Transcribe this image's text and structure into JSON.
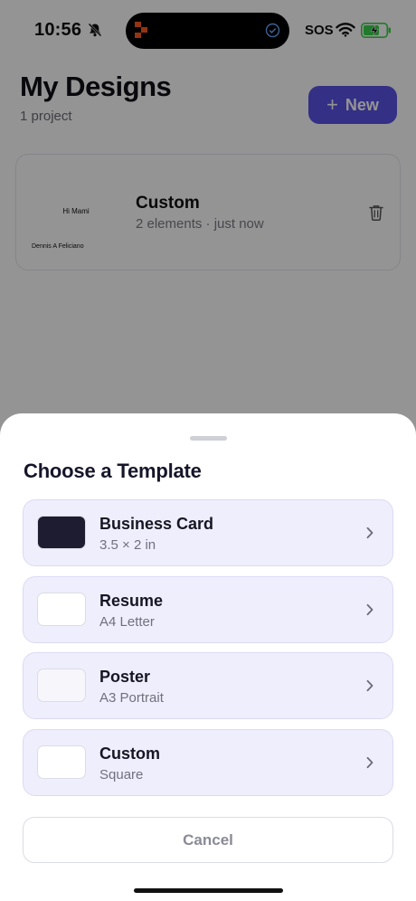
{
  "status_bar": {
    "time": "10:56",
    "sos": "SOS",
    "icons": [
      "bell-slash-icon",
      "app-logo-icon",
      "check-circle-icon",
      "wifi-icon",
      "battery-charging-icon"
    ]
  },
  "header": {
    "title": "My Designs",
    "subtitle": "1 project",
    "new_button_label": "New",
    "new_button_icon": "+"
  },
  "projects": [
    {
      "name": "Custom",
      "meta": "2 elements · just now",
      "thumbnail_texts": [
        "Hi Mami",
        "Dennis A Feliciano"
      ]
    }
  ],
  "sheet": {
    "title": "Choose a Template",
    "templates": [
      {
        "name": "Business Card",
        "size": "3.5 × 2 in",
        "swatch_color": "#1d1c30"
      },
      {
        "name": "Resume",
        "size": "A4 Letter",
        "swatch_color": "#ffffff"
      },
      {
        "name": "Poster",
        "size": "A3 Portrait",
        "swatch_color": "#f6f6fb"
      },
      {
        "name": "Custom",
        "size": "Square",
        "swatch_color": "#ffffff"
      }
    ],
    "cancel_label": "Cancel"
  },
  "colors": {
    "accent": "#5b54e6",
    "template_row_bg": "#efeefc",
    "overlay": "rgba(0,0,0,0.42)"
  }
}
